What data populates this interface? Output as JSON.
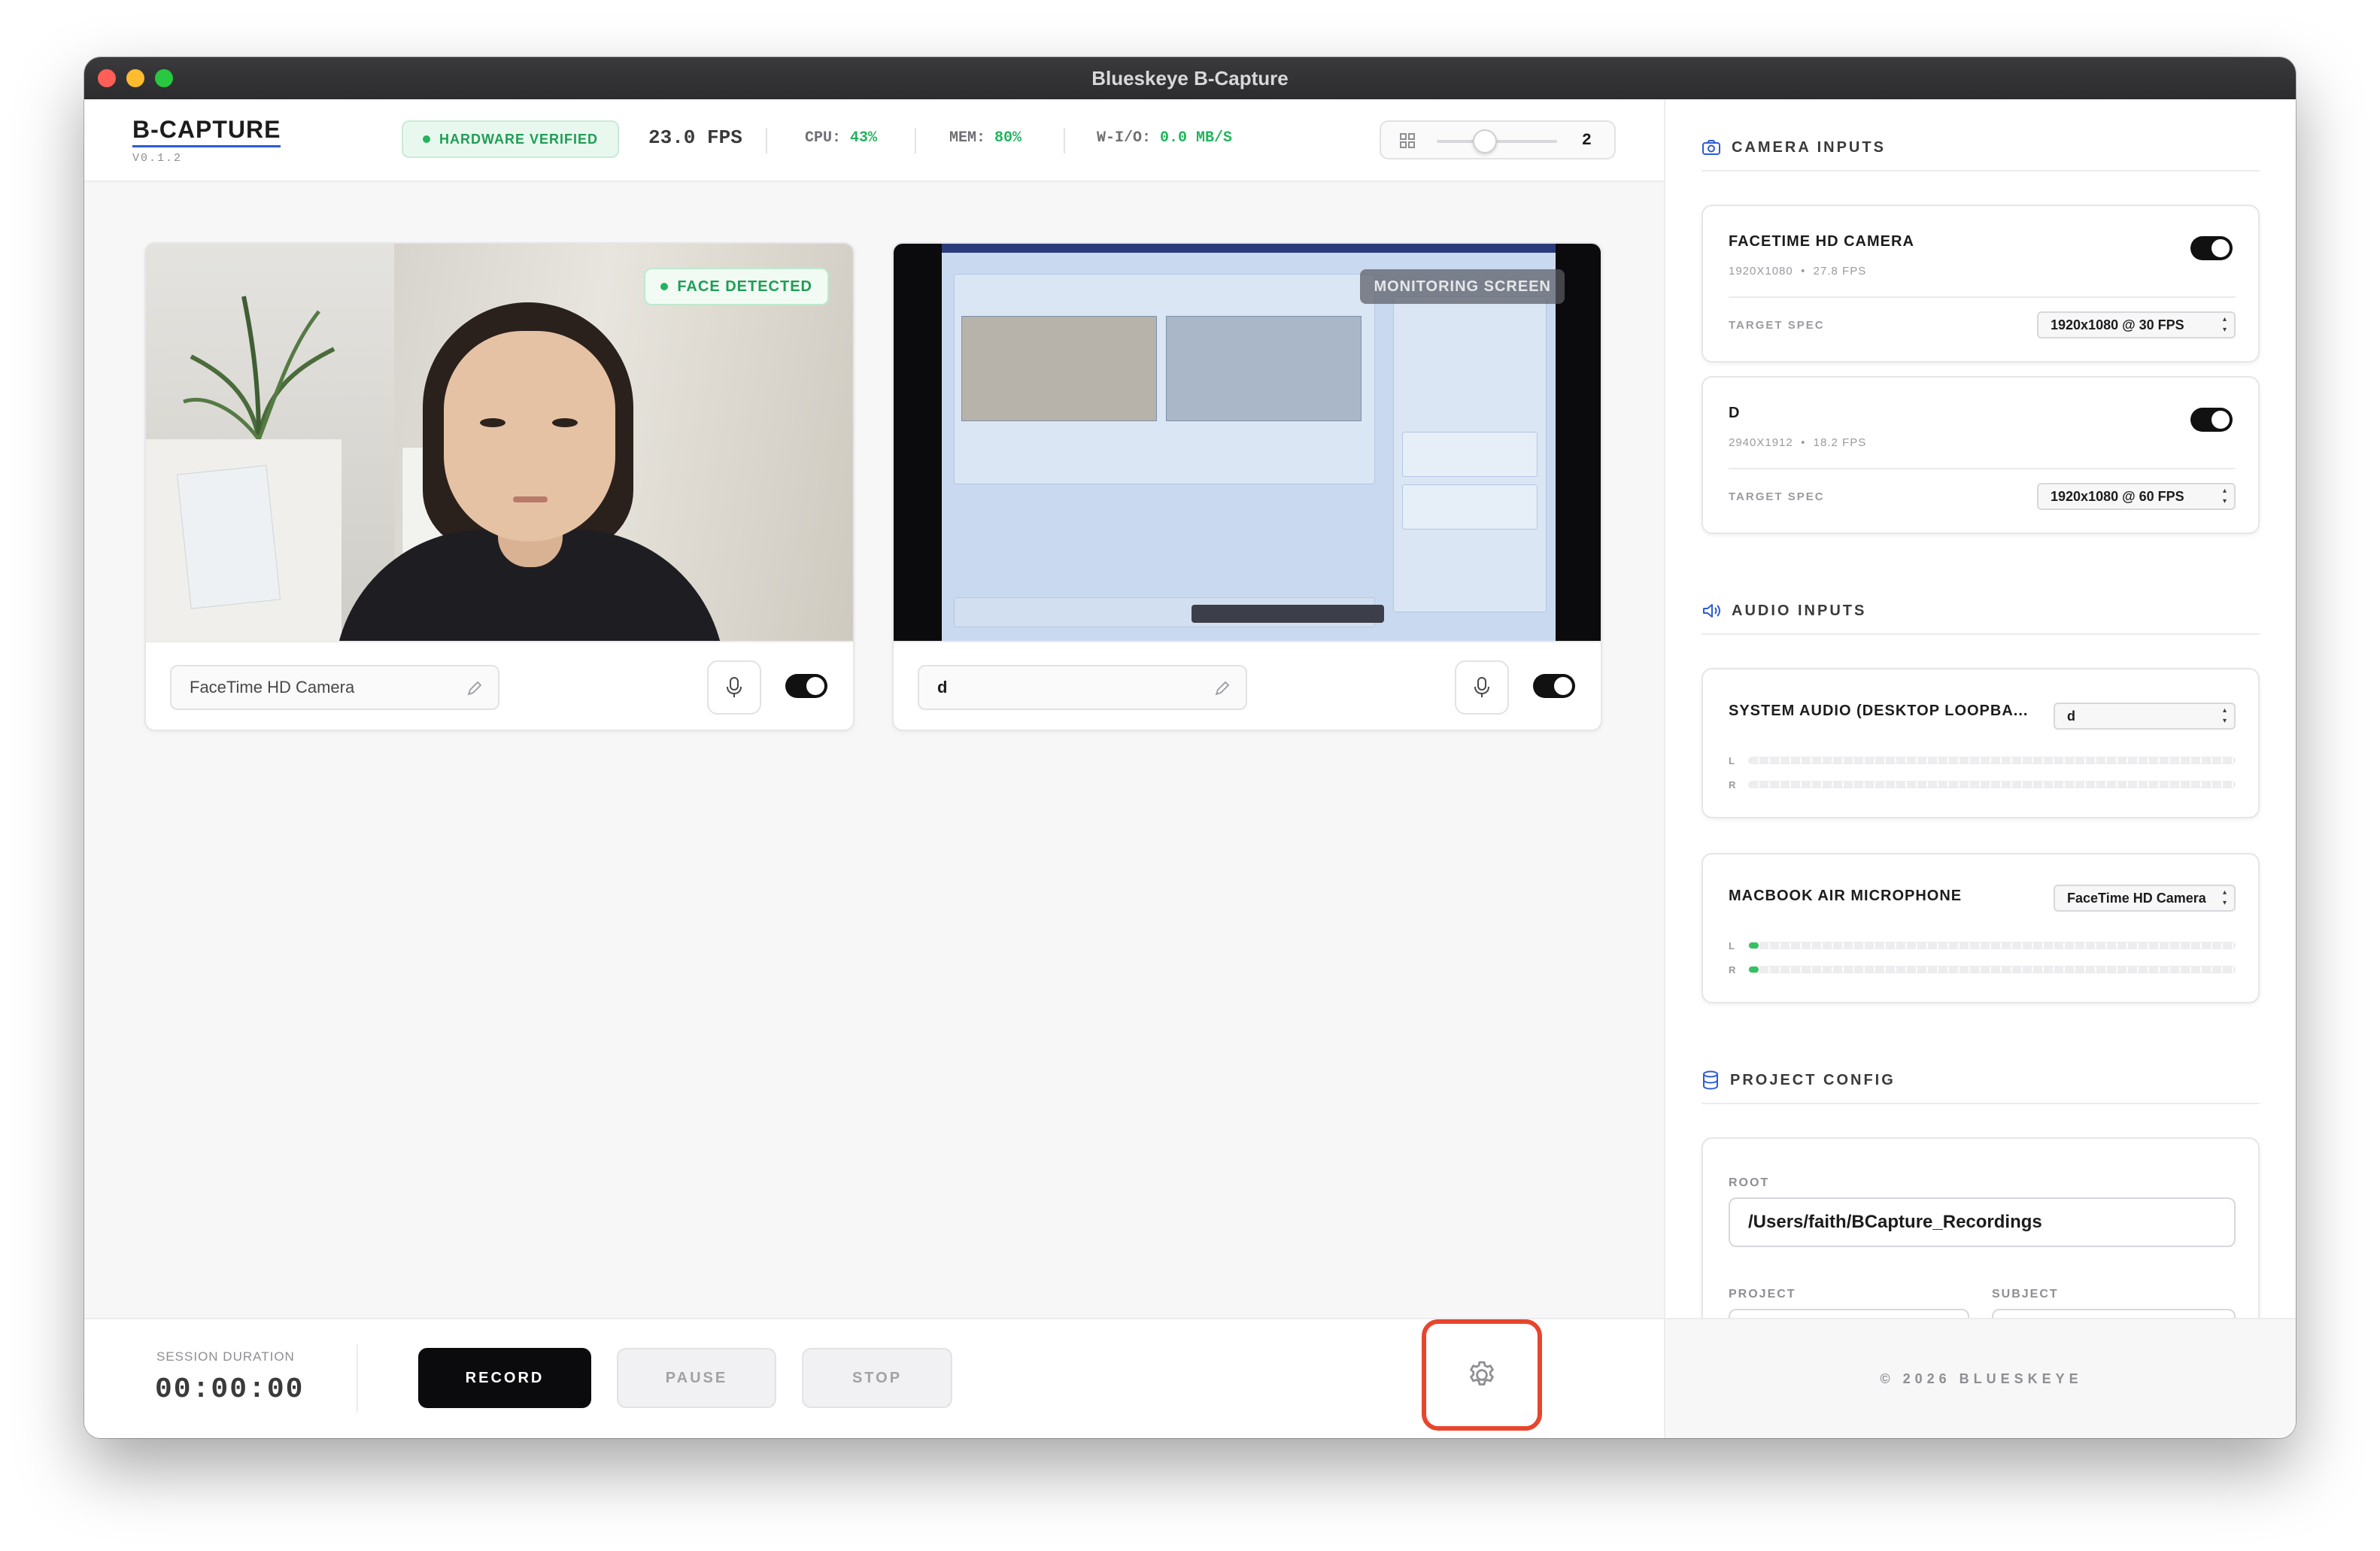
{
  "window": {
    "title": "Blueskeye B-Capture"
  },
  "brand": {
    "title": "B-CAPTURE",
    "version": "V0.1.2"
  },
  "header": {
    "hardware_badge": "HARDWARE VERIFIED",
    "fps": "23.0 FPS",
    "cpu_label": "CPU:",
    "cpu_value": "43%",
    "mem_label": "MEM:",
    "mem_value": "80%",
    "wio_label": "W-I/O:",
    "wio_value": "0.0 MB/S",
    "grid_value": "2",
    "grid_slider_fraction": 0.4
  },
  "previews": [
    {
      "name": "FaceTime HD Camera",
      "badge": "FACE DETECTED",
      "enabled": true
    },
    {
      "name": "d",
      "badge": "MONITORING SCREEN",
      "enabled": true
    }
  ],
  "footer": {
    "session_label": "SESSION DURATION",
    "session_time": "00:00:00",
    "record": "RECORD",
    "pause": "PAUSE",
    "stop": "STOP"
  },
  "sidebar": {
    "camera_section": "CAMERA INPUTS",
    "cameras": [
      {
        "title": "FACETIME HD CAMERA",
        "resolution": "1920X1080",
        "fps": "27.8 FPS",
        "spec_label": "TARGET SPEC",
        "spec": "1920x1080 @ 30 FPS",
        "enabled": true
      },
      {
        "title": "D",
        "resolution": "2940X1912",
        "fps": "18.2 FPS",
        "spec_label": "TARGET SPEC",
        "spec": "1920x1080 @ 60 FPS",
        "enabled": true
      }
    ],
    "audio_section": "AUDIO INPUTS",
    "audio": [
      {
        "title": "SYSTEM AUDIO (DESKTOP LOOPBA...",
        "device": "d",
        "level_l": 0,
        "level_r": 0
      },
      {
        "title": "MACBOOK AIR MICROPHONE",
        "device": "FaceTime HD Camera",
        "level_l": 0.02,
        "level_r": 0.02
      }
    ],
    "meter_l": "L",
    "meter_r": "R",
    "project_section": "PROJECT CONFIG",
    "root_label": "ROOT",
    "root_value": "/Users/faith/BCapture_Recordings",
    "project_label": "PROJECT",
    "subject_label": "SUBJECT",
    "copyright": "© 2026 BLUESKEYE"
  },
  "colors": {
    "accent": "#2c5bd6",
    "success": "#22b35e",
    "highlight": "#e8452d"
  }
}
